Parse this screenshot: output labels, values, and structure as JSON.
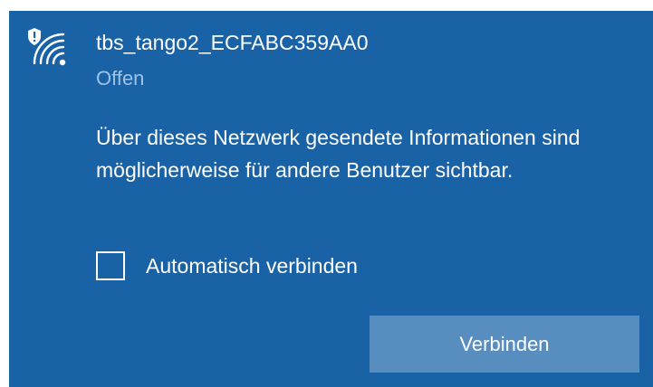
{
  "network": {
    "ssid": "tbs_tango2_ECFABC359AA0",
    "status": "Offen",
    "icon": "wifi-unsecured-icon",
    "warning": "Über dieses Netzwerk gesendete Informationen sind möglicherweise für andere Benutzer sichtbar."
  },
  "auto_connect": {
    "label": "Automatisch verbinden",
    "checked": false
  },
  "connect_button": {
    "label": "Verbinden"
  },
  "colors": {
    "panel_background": "#1a62a6",
    "status_text": "#9ec3e6",
    "button_background": "#588dbf",
    "text": "#ffffff"
  }
}
